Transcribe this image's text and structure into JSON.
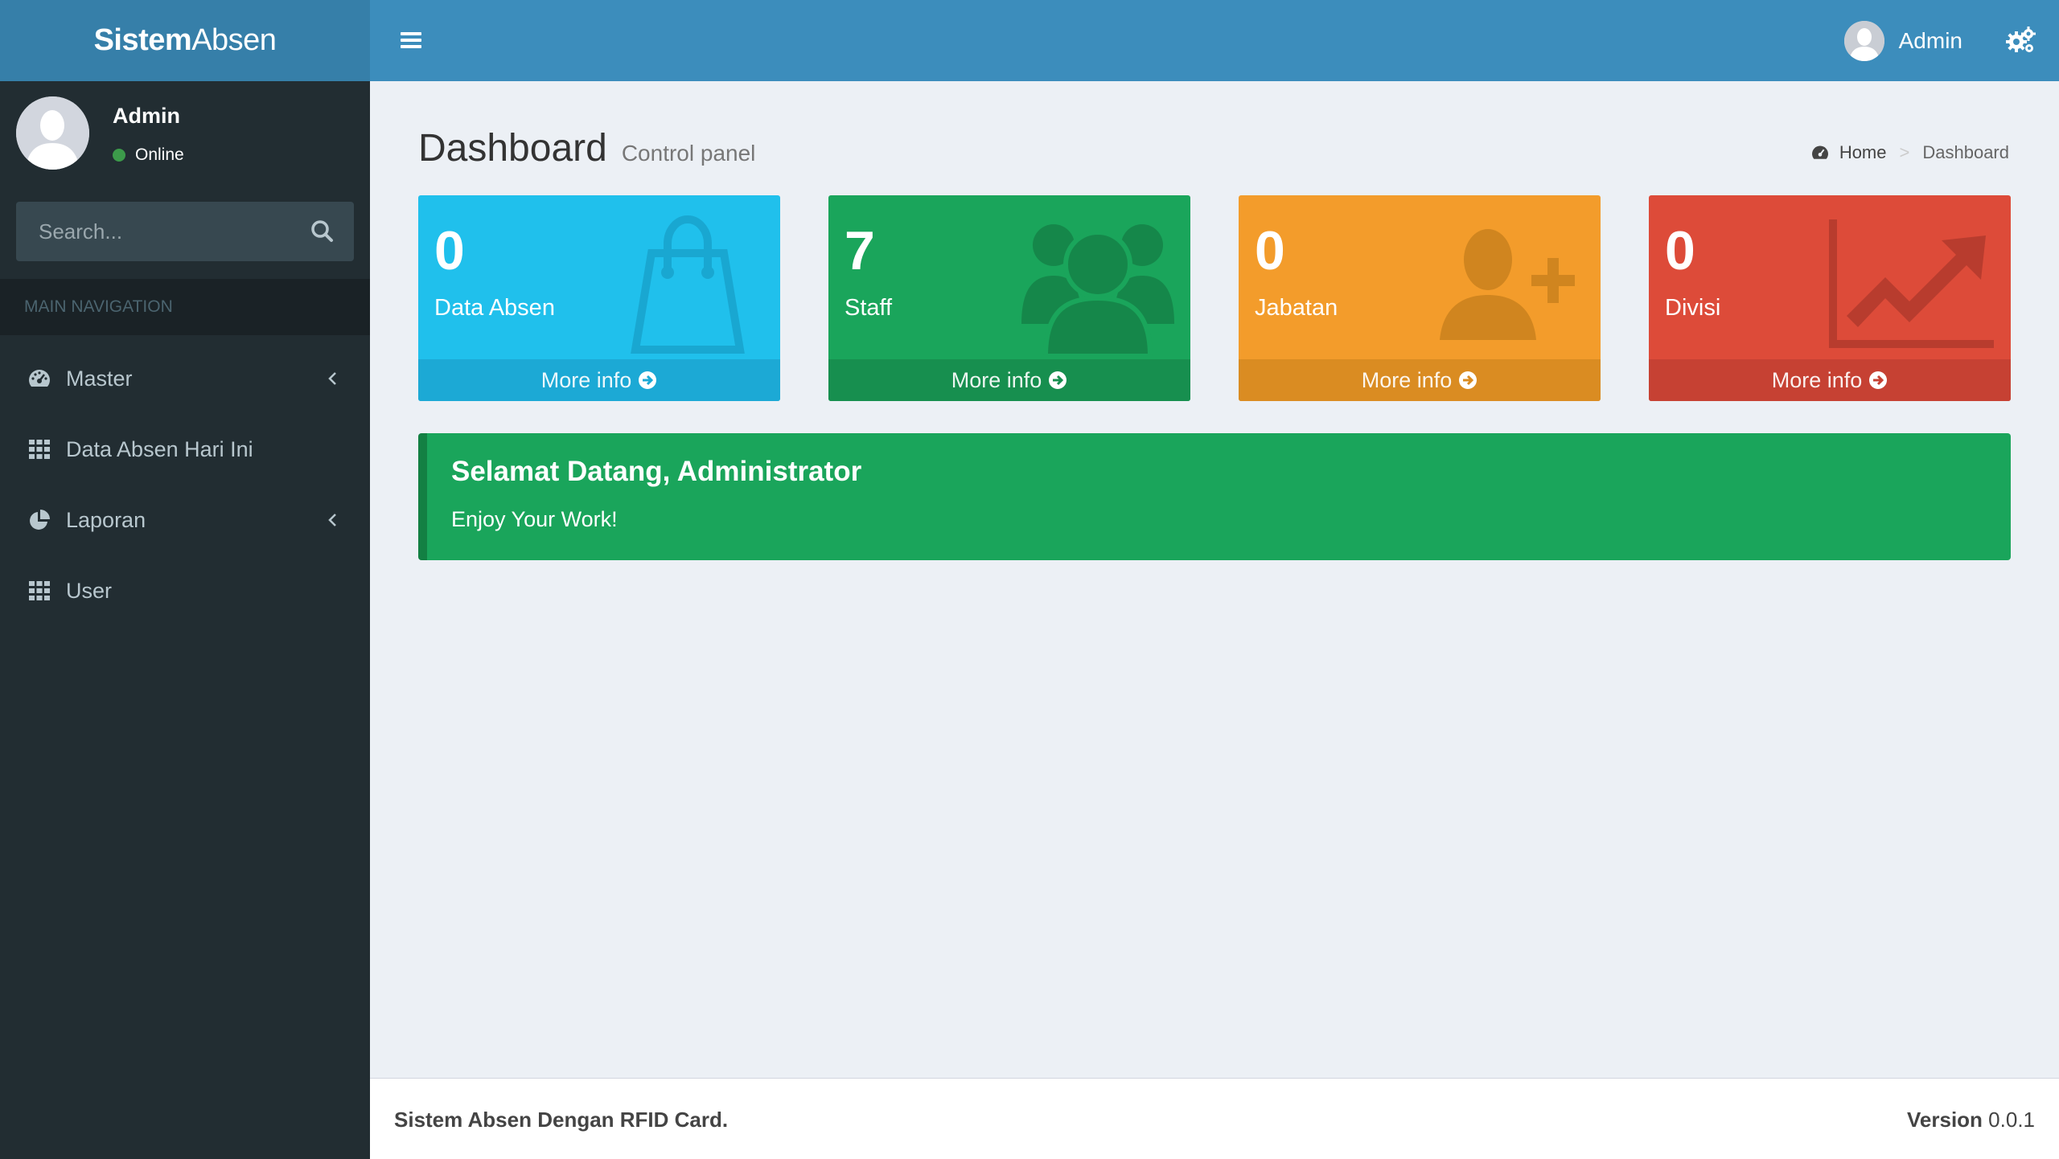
{
  "brand": {
    "bold": "Sistem",
    "light": "Absen"
  },
  "navbar": {
    "user_name": "Admin"
  },
  "sidebar": {
    "user": {
      "name": "Admin",
      "status": "Online"
    },
    "search": {
      "placeholder": "Search..."
    },
    "nav_header": "MAIN NAVIGATION",
    "items": [
      {
        "label": "Master",
        "icon": "dashboard-icon",
        "has_submenu": true
      },
      {
        "label": "Data Absen Hari Ini",
        "icon": "grid-icon",
        "has_submenu": false
      },
      {
        "label": "Laporan",
        "icon": "pie-chart-icon",
        "has_submenu": true
      },
      {
        "label": "User",
        "icon": "grid-icon",
        "has_submenu": false
      }
    ]
  },
  "content": {
    "title": "Dashboard",
    "subtitle": "Control panel",
    "breadcrumb": {
      "home": "Home",
      "current": "Dashboard"
    },
    "boxes": [
      {
        "value": "0",
        "label": "Data Absen",
        "more": "More info",
        "icon": "shopping-bag-icon",
        "color": "#00c0ef"
      },
      {
        "value": "7",
        "label": "Staff",
        "more": "More info",
        "icon": "users-icon",
        "color": "#1aa55b"
      },
      {
        "value": "0",
        "label": "Jabatan",
        "more": "More info",
        "icon": "user-plus-icon",
        "color": "#f39c12"
      },
      {
        "value": "0",
        "label": "Divisi",
        "more": "More info",
        "icon": "line-chart-icon",
        "color": "#dd4b39"
      }
    ],
    "callout": {
      "heading": "Selamat Datang, Administrator",
      "text": "Enjoy Your Work!"
    }
  },
  "footer": {
    "left": "Sistem Absen Dengan RFID Card.",
    "version_label": "Version",
    "version": "0.0.1"
  }
}
